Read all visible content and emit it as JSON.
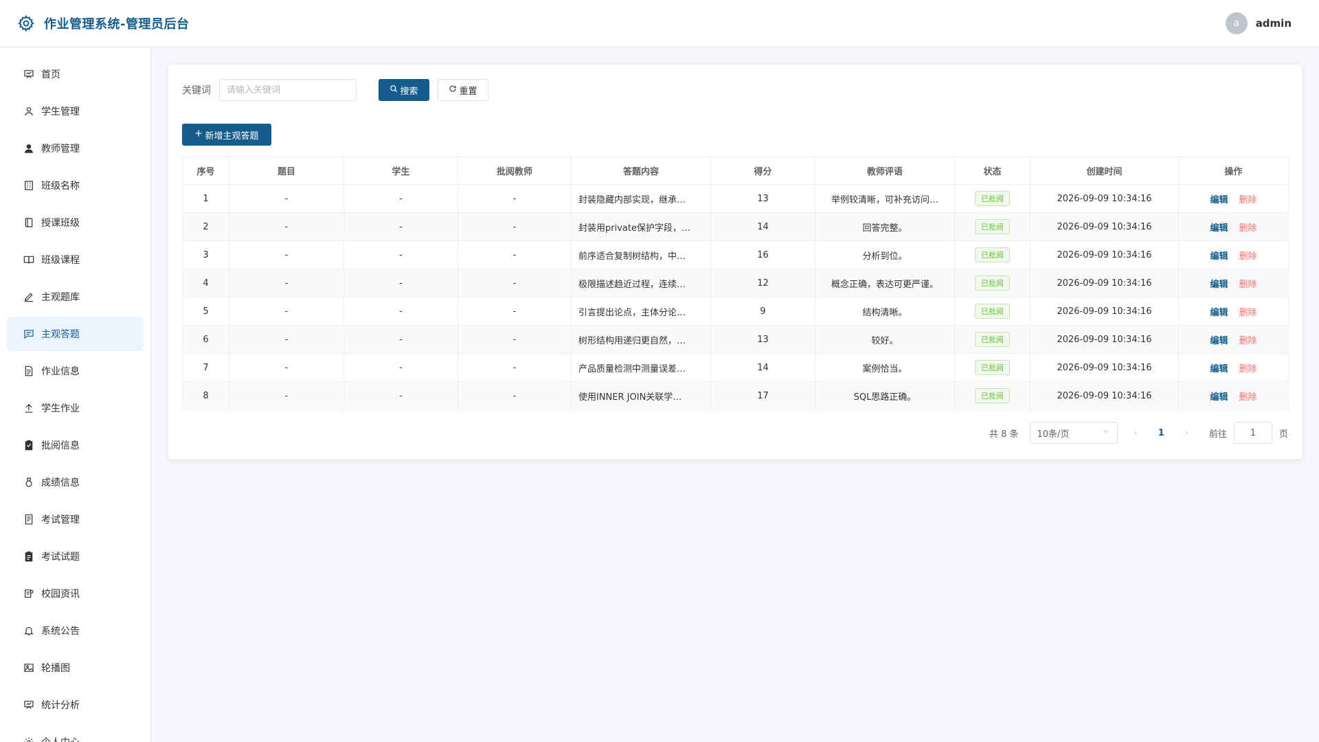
{
  "header": {
    "title": "作业管理系统-管理员后台",
    "avatar_letter": "a",
    "username": "admin"
  },
  "sidebar": {
    "items": [
      {
        "label": "首页",
        "icon": "dashboard-icon"
      },
      {
        "label": "学生管理",
        "icon": "user-icon"
      },
      {
        "label": "教师管理",
        "icon": "user-filled-icon"
      },
      {
        "label": "班级名称",
        "icon": "building-icon"
      },
      {
        "label": "授课班级",
        "icon": "book-icon"
      },
      {
        "label": "班级课程",
        "icon": "open-book-icon"
      },
      {
        "label": "主观题库",
        "icon": "edit-icon"
      },
      {
        "label": "主观答题",
        "icon": "chat-icon",
        "active": true
      },
      {
        "label": "作业信息",
        "icon": "document-icon"
      },
      {
        "label": "学生作业",
        "icon": "upload-icon"
      },
      {
        "label": "批阅信息",
        "icon": "checklist-icon"
      },
      {
        "label": "成绩信息",
        "icon": "medal-icon"
      },
      {
        "label": "考试管理",
        "icon": "tickets-icon"
      },
      {
        "label": "考试试题",
        "icon": "clipboard-icon"
      },
      {
        "label": "校园资讯",
        "icon": "news-icon"
      },
      {
        "label": "系统公告",
        "icon": "bell-icon"
      },
      {
        "label": "轮播图",
        "icon": "picture-icon"
      },
      {
        "label": "统计分析",
        "icon": "chart-icon"
      },
      {
        "label": "个人中心",
        "icon": "settings-icon"
      }
    ]
  },
  "search": {
    "label": "关键词",
    "placeholder": "请输入关键词",
    "search_label": "搜索",
    "reset_label": "重置"
  },
  "toolbar": {
    "add_label": "新增主观答题"
  },
  "table": {
    "columns": [
      "序号",
      "题目",
      "学生",
      "批阅教师",
      "答题内容",
      "得分",
      "教师评语",
      "状态",
      "创建时间",
      "操作"
    ],
    "rows": [
      {
        "no": "1",
        "question": "-",
        "student": "-",
        "teacher": "-",
        "content": "封装隐藏内部实现，继承…",
        "score": "13",
        "comment": "举例较清晰，可补充访问…",
        "status": "已批阅",
        "created": "2026-09-09 10:34:16"
      },
      {
        "no": "2",
        "question": "-",
        "student": "-",
        "teacher": "-",
        "content": "封装用private保护字段，…",
        "score": "14",
        "comment": "回答完整。",
        "status": "已批阅",
        "created": "2026-09-09 10:34:16"
      },
      {
        "no": "3",
        "question": "-",
        "student": "-",
        "teacher": "-",
        "content": "前序适合复制树结构，中…",
        "score": "16",
        "comment": "分析到位。",
        "status": "已批阅",
        "created": "2026-09-09 10:34:16"
      },
      {
        "no": "4",
        "question": "-",
        "student": "-",
        "teacher": "-",
        "content": "极限描述趋近过程，连续…",
        "score": "12",
        "comment": "概念正确，表达可更严谨。",
        "status": "已批阅",
        "created": "2026-09-09 10:34:16"
      },
      {
        "no": "5",
        "question": "-",
        "student": "-",
        "teacher": "-",
        "content": "引言提出论点，主体分论…",
        "score": "9",
        "comment": "结构清晰。",
        "status": "已批阅",
        "created": "2026-09-09 10:34:16"
      },
      {
        "no": "6",
        "question": "-",
        "student": "-",
        "teacher": "-",
        "content": "树形结构用递归更自然，…",
        "score": "13",
        "comment": "较好。",
        "status": "已批阅",
        "created": "2026-09-09 10:34:16"
      },
      {
        "no": "7",
        "question": "-",
        "student": "-",
        "teacher": "-",
        "content": "产品质量检测中测量误差…",
        "score": "14",
        "comment": "案例恰当。",
        "status": "已批阅",
        "created": "2026-09-09 10:34:16"
      },
      {
        "no": "8",
        "question": "-",
        "student": "-",
        "teacher": "-",
        "content": "使用INNER JOIN关联学…",
        "score": "17",
        "comment": "SQL思路正确。",
        "status": "已批阅",
        "created": "2026-09-09 10:34:16"
      }
    ],
    "edit_label": "编辑",
    "delete_label": "删除"
  },
  "pagination": {
    "total_text": "共 8 条",
    "page_size": "10条/页",
    "current_page": "1",
    "goto_label": "前往",
    "goto_value": "1",
    "page_suffix": "页"
  },
  "colors": {
    "primary": "#135c8c",
    "danger": "#f56c6c",
    "success": "#67c23a"
  }
}
